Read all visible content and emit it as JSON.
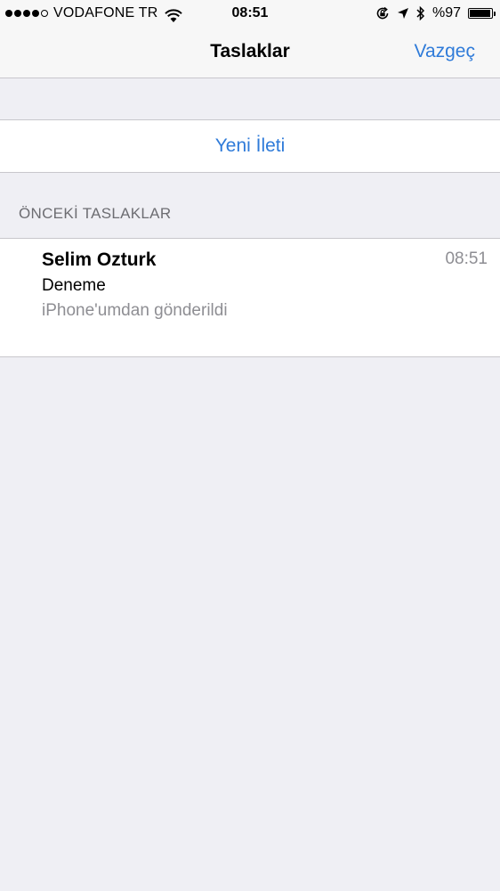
{
  "status_bar": {
    "carrier": "VODAFONE TR",
    "time": "08:51",
    "battery": "%97",
    "battery_level": 0.97,
    "signal_bars": 4,
    "signal_total": 5
  },
  "nav": {
    "title": "Taslaklar",
    "cancel_label": "Vazgeç"
  },
  "new_message": {
    "label": "Yeni İleti"
  },
  "section": {
    "header": "ÖNCEKİ TASLAKLAR"
  },
  "drafts": [
    {
      "sender": "Selim Ozturk",
      "time": "08:51",
      "subject": "Deneme",
      "preview": "iPhone'umdan gönderildi"
    }
  ],
  "colors": {
    "accent": "#2f7bd9",
    "background": "#efeff4",
    "secondary_text": "#8e8e93"
  }
}
